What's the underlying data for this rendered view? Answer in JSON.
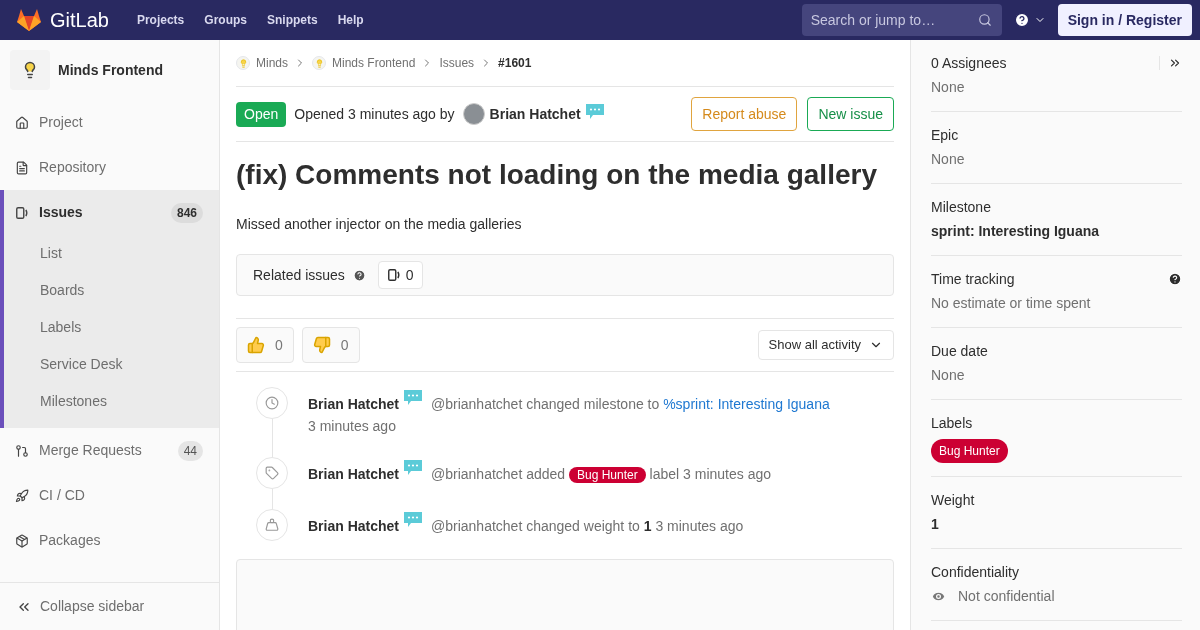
{
  "navbar": {
    "brand": "GitLab",
    "links": [
      "Projects",
      "Groups",
      "Snippets",
      "Help"
    ],
    "search": {
      "placeholder": "Search or jump to…"
    },
    "sign_in": "Sign in / Register"
  },
  "sidebar": {
    "project": "Minds Frontend",
    "items": [
      {
        "kind": "home",
        "label": "Project",
        "selected": false
      },
      {
        "kind": "file",
        "label": "Repository",
        "selected": false
      },
      {
        "kind": "issues",
        "label": "Issues",
        "count": "846",
        "selected": true,
        "children": [
          {
            "label": "List"
          },
          {
            "label": "Boards"
          },
          {
            "label": "Labels"
          },
          {
            "label": "Service Desk"
          },
          {
            "label": "Milestones"
          }
        ]
      },
      {
        "kind": "merge",
        "label": "Merge Requests",
        "count": "44",
        "selected": false
      },
      {
        "kind": "rocket",
        "label": "CI / CD",
        "selected": false
      },
      {
        "kind": "package",
        "label": "Packages",
        "selected": false
      }
    ],
    "collapse": "Collapse sidebar"
  },
  "breadcrumbs": [
    {
      "label": "Minds",
      "kind": "project"
    },
    {
      "label": "Minds Frontend",
      "kind": "project"
    },
    {
      "label": "Issues",
      "kind": "plain"
    },
    {
      "label": "#1601",
      "kind": "current"
    }
  ],
  "issue": {
    "status": "Open",
    "opened": "Opened 3 minutes ago by",
    "author": "Brian Hatchet",
    "actions": [
      {
        "label": "Report abuse",
        "kind": "warning"
      },
      {
        "label": "New issue",
        "kind": "success"
      }
    ],
    "title": "(fix) Comments not loading on the media gallery",
    "description": "Missed another injector on the media galleries",
    "related": {
      "label": "Related issues",
      "count": "0"
    },
    "reactions": [
      {
        "kind": "up",
        "count": "0"
      },
      {
        "kind": "down",
        "count": "0"
      }
    ],
    "activity_filter": "Show all activity"
  },
  "notes": [
    {
      "kind": "clock",
      "author": "Brian Hatchet",
      "parts": [
        {
          "kind": "text",
          "text": "@brianhatchet changed milestone to "
        },
        {
          "kind": "link",
          "text": "%sprint: Interesting Iguana"
        },
        {
          "kind": "time",
          "text": "3 minutes ago"
        }
      ]
    },
    {
      "kind": "tag",
      "author": "Brian Hatchet",
      "parts": [
        {
          "kind": "text",
          "text": "@brianhatchet added "
        },
        {
          "kind": "label",
          "text": "Bug Hunter",
          "color": "#cc0033"
        },
        {
          "kind": "text",
          "text": " label 3 minutes ago"
        }
      ]
    },
    {
      "kind": "weight",
      "author": "Brian Hatchet",
      "parts": [
        {
          "kind": "text",
          "text": "@brianhatchet changed weight to **1** 3 minutes ago"
        }
      ]
    }
  ],
  "right_sidebar": [
    {
      "kind": "plain",
      "title": "0 Assignees",
      "value": "None",
      "collapse": true
    },
    {
      "kind": "plain",
      "title": "Epic",
      "value": "None"
    },
    {
      "kind": "bold",
      "title": "Milestone",
      "value": "sprint: Interesting Iguana"
    },
    {
      "kind": "plain",
      "title": "Time tracking",
      "value": "No estimate or time spent",
      "help": true
    },
    {
      "kind": "plain",
      "title": "Due date",
      "value": "None"
    },
    {
      "kind": "label",
      "title": "Labels",
      "value": "Bug Hunter",
      "color": "#cc0033"
    },
    {
      "kind": "bold",
      "title": "Weight",
      "value": "1"
    },
    {
      "kind": "eye",
      "title": "Confidentiality",
      "value": "Not confidential"
    }
  ]
}
